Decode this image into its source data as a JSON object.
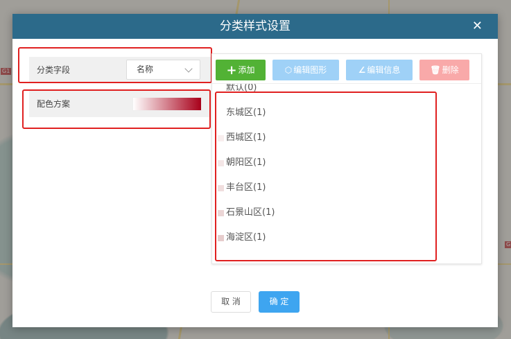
{
  "dialog": {
    "title": "分类样式设置",
    "close_glyph": "✕"
  },
  "left_panel": {
    "field_label": "分类字段",
    "field_value": "名称",
    "color_label": "配色方案",
    "gradient": {
      "from": "#ffffff",
      "to": "#a8001a"
    }
  },
  "toolbar": {
    "add": {
      "icon": "plus-icon",
      "glyph": "+",
      "label": "添加"
    },
    "edit_shape": {
      "icon": "shape-icon",
      "glyph": "⬡",
      "label": "编辑图形"
    },
    "edit_info": {
      "icon": "pencil-icon",
      "glyph": "∠",
      "label": "编辑信息"
    },
    "delete": {
      "icon": "trash-icon",
      "glyph": "🗑",
      "label": "删除"
    }
  },
  "categories": [
    {
      "label": "默认(0)",
      "color": "#ffffff"
    },
    {
      "label": "东城区(1)",
      "color": "#ffffff"
    },
    {
      "label": "西城区(1)",
      "color": "#f8eeee"
    },
    {
      "label": "朝阳区(1)",
      "color": "#f4e6e6"
    },
    {
      "label": "丰台区(1)",
      "color": "#f0dede"
    },
    {
      "label": "石景山区(1)",
      "color": "#ebd5d5"
    },
    {
      "label": "海淀区(1)",
      "color": "#e6cccc"
    }
  ],
  "footer": {
    "cancel": "取 消",
    "ok": "确 定"
  },
  "colors": {
    "header": "#2c6a8a",
    "add_button": "#52b235",
    "edit_button": "#9fd1f7",
    "delete_button": "#f9a9a9",
    "ok_button": "#3ea5f0",
    "highlight_border": "#e02020"
  },
  "map_labels": [
    "G1",
    "G"
  ]
}
